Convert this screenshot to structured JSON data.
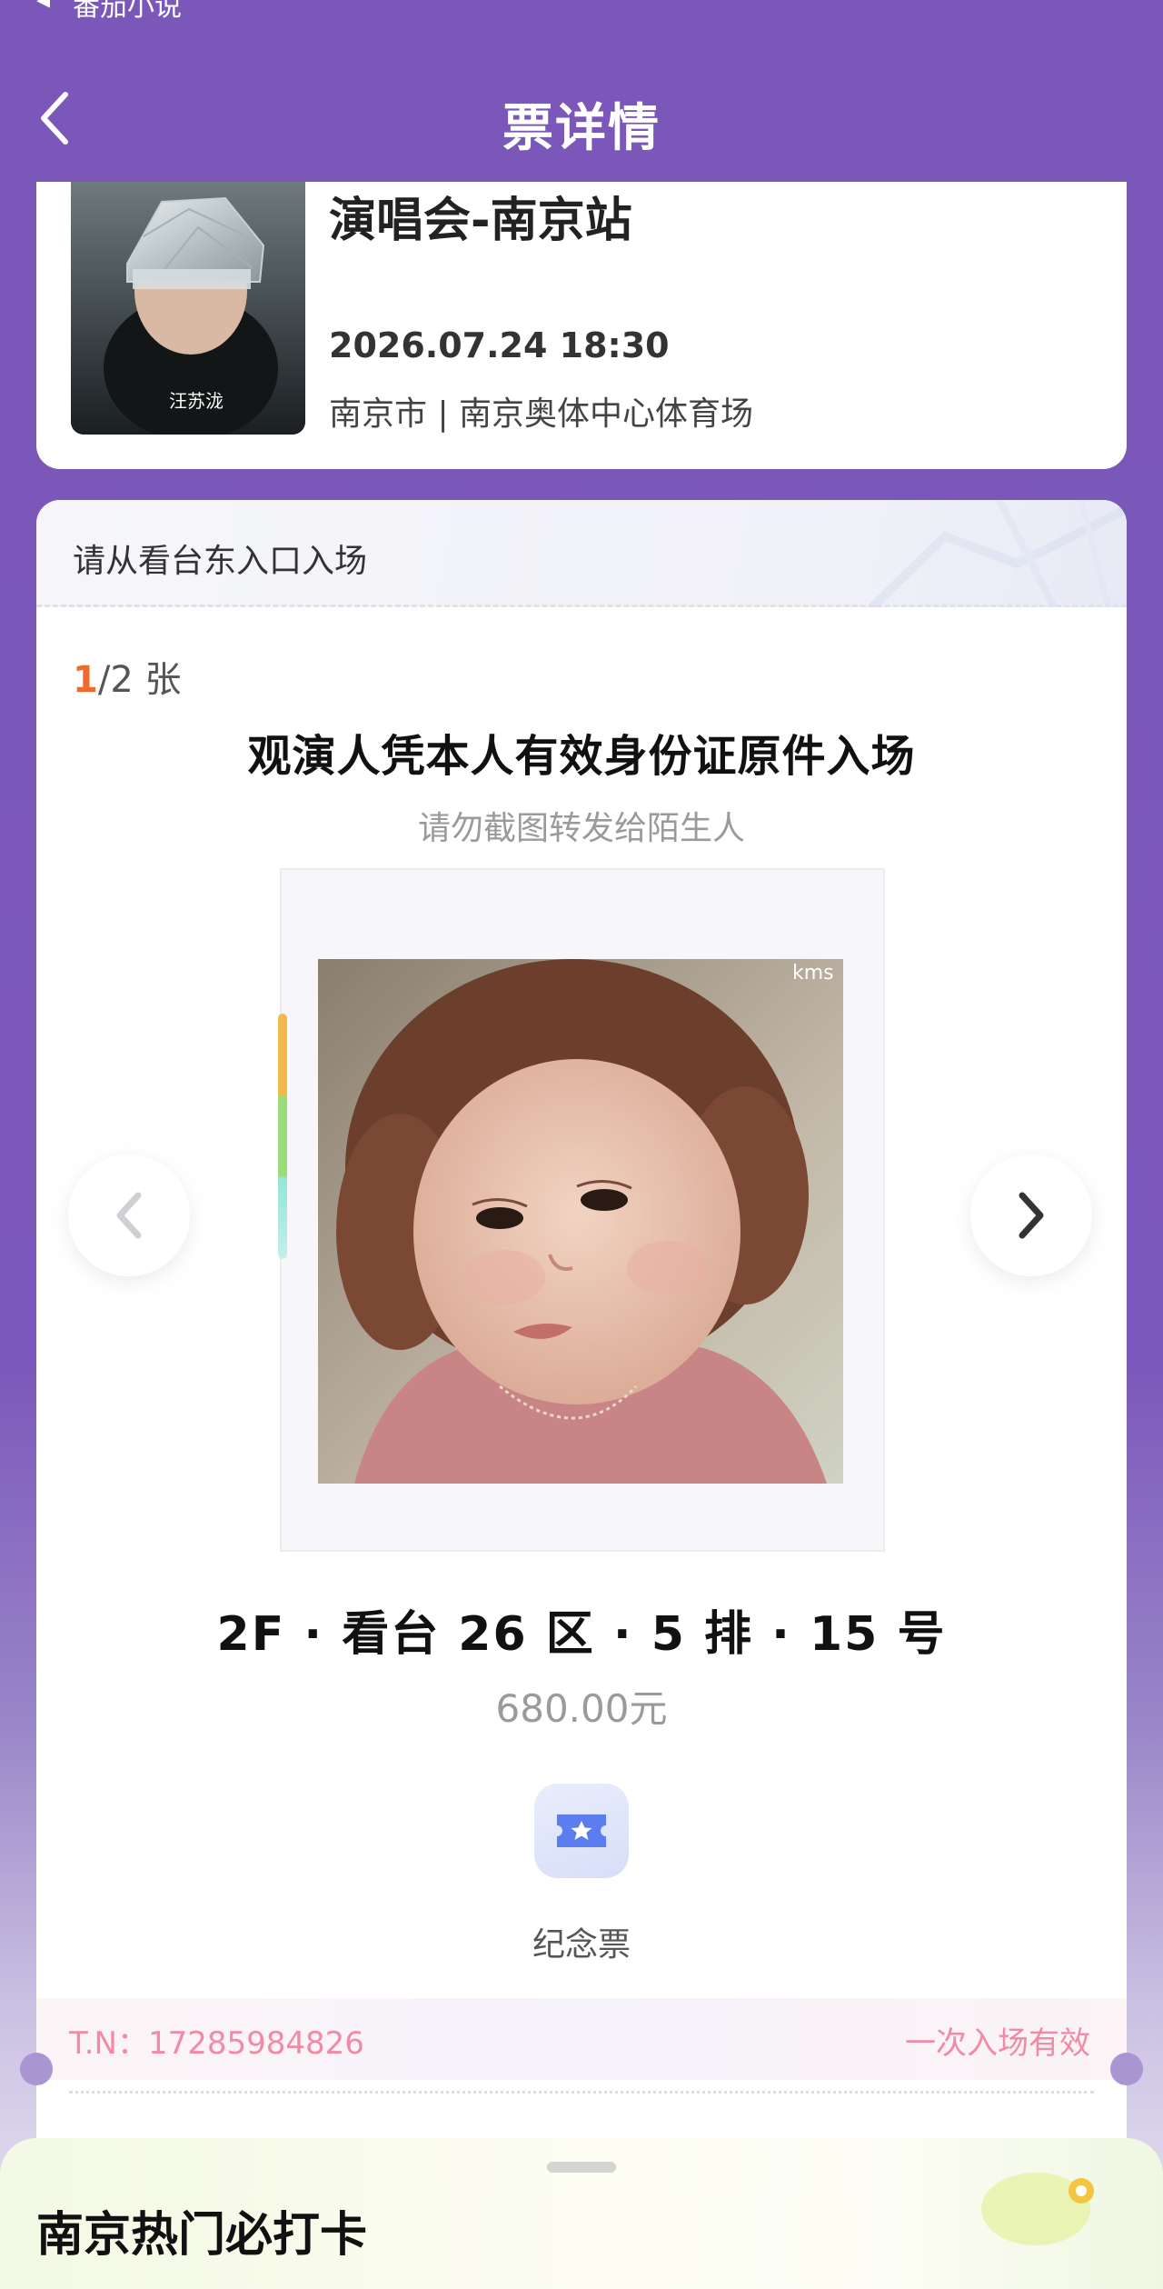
{
  "status_bar": {
    "text": "番茄小说"
  },
  "nav": {
    "title": "票详情"
  },
  "event": {
    "title": "演唱会-南京站",
    "datetime": "2026.07.24 18:30",
    "venue": "南京市 | 南京奥体中心体育场",
    "poster_text": "汪苏泷"
  },
  "ticket": {
    "entrance": "请从看台东入口入场",
    "current_index": "1",
    "count_rest": "/2 张",
    "id_notice": "观演人凭本人有效身份证原件入场",
    "warning": "请勿截图转发给陌生人",
    "photo_watermark": "kms",
    "seat": "2F · 看台 26 区 · 5 排 · 15 号",
    "price": "680.00元",
    "souvenir_label": "纪念票",
    "tn": "T.N：17285984826",
    "validity": "一次入场有效"
  },
  "bottom_sheet": {
    "title": "南京热门必打卡"
  },
  "colors": {
    "header_purple": "#7a57b8",
    "accent_orange": "#f2692c",
    "tn_pink": "#f18aa4"
  }
}
